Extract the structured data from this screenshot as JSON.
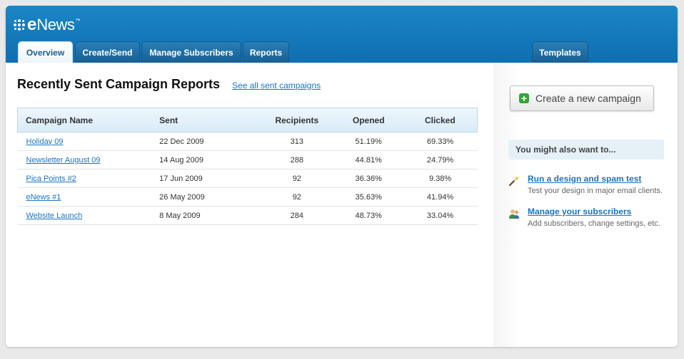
{
  "app": {
    "logo_e": "e",
    "logo_news": "News",
    "logo_tm": "™"
  },
  "tabs": [
    {
      "label": "Overview",
      "active": true
    },
    {
      "label": "Create/Send",
      "active": false
    },
    {
      "label": "Manage Subscribers",
      "active": false
    },
    {
      "label": "Reports",
      "active": false
    },
    {
      "label": "Templates",
      "active": false
    }
  ],
  "main": {
    "title": "Recently Sent Campaign Reports",
    "see_all_label": "See all sent campaigns",
    "table": {
      "headers": [
        "Campaign Name",
        "Sent",
        "Recipients",
        "Opened",
        "Clicked"
      ],
      "rows": [
        {
          "name": "Holiday 09",
          "sent": "22 Dec 2009",
          "recipients": "313",
          "opened": "51.19%",
          "clicked": "69.33%"
        },
        {
          "name": "Newsletter August 09",
          "sent": "14 Aug 2009",
          "recipients": "288",
          "opened": "44.81%",
          "clicked": "24.79%"
        },
        {
          "name": "Pica Points #2",
          "sent": "17 Jun 2009",
          "recipients": "92",
          "opened": "36.36%",
          "clicked": "9.38%"
        },
        {
          "name": "eNews #1",
          "sent": "26 May 2009",
          "recipients": "92",
          "opened": "35.63%",
          "clicked": "41.94%"
        },
        {
          "name": "Website Launch",
          "sent": "8 May 2009",
          "recipients": "284",
          "opened": "48.73%",
          "clicked": "33.04%"
        }
      ]
    }
  },
  "sidebar": {
    "new_campaign_label": "Create a new campaign",
    "new_campaign_icon": "plus-icon",
    "also_title": "You might also want to...",
    "suggestions": [
      {
        "icon": "magic-wand-icon",
        "link": "Run a design and spam test",
        "desc": "Test your design in major email clients."
      },
      {
        "icon": "users-icon",
        "link": "Manage your subscribers",
        "desc": "Add subscribers, change settings, etc."
      }
    ]
  },
  "colors": {
    "header": "#1579bd",
    "link": "#1a74c4",
    "accent_green": "#35a33a"
  }
}
